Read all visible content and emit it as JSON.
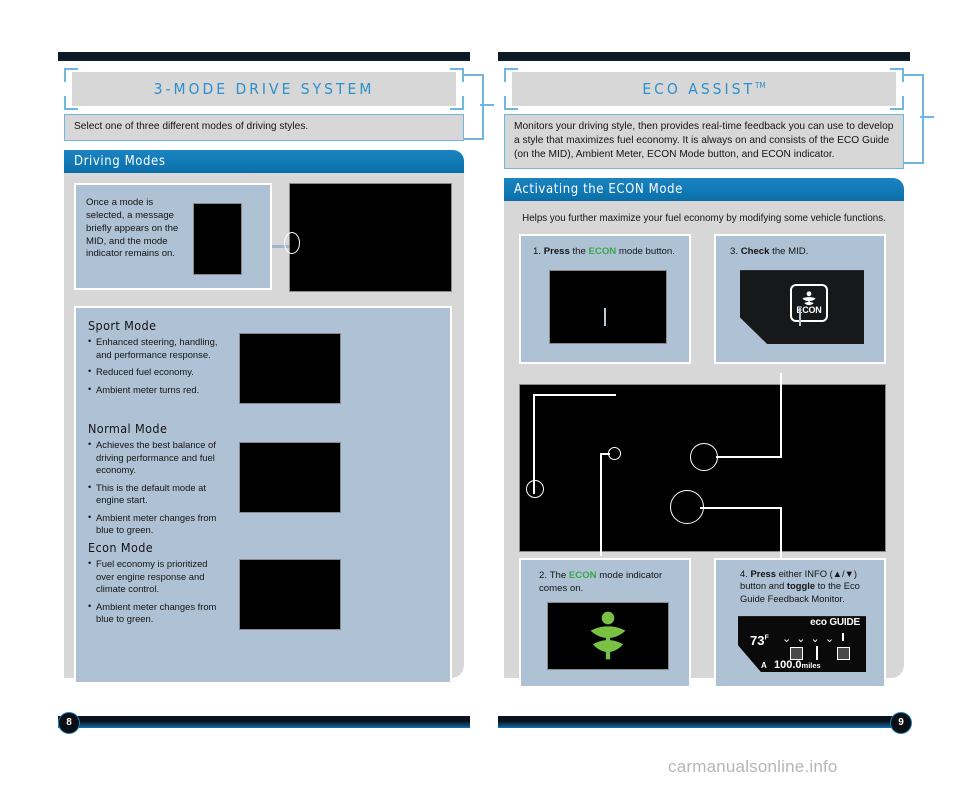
{
  "left_page": {
    "page_number": "8",
    "title": "3-MODE DRIVE SYSTEM",
    "intro": "Select one of three different modes of driving styles.",
    "section": {
      "heading": "Driving Modes",
      "note_box": {
        "text": "Once a mode is selected, a message briefly appears on the MID, and the mode indicator remains on."
      },
      "modes": [
        {
          "name": "Sport Mode",
          "bullets": [
            "Enhanced steering, handling, and performance response.",
            "Reduced fuel economy.",
            "Ambient meter turns red."
          ]
        },
        {
          "name": "Normal Mode",
          "bullets": [
            "Achieves the best balance of driving performance and fuel economy.",
            "This is the default mode at engine start.",
            "Ambient meter changes from blue to green."
          ]
        },
        {
          "name": "Econ Mode",
          "bullets": [
            "Fuel economy is prioritized over engine response and climate control.",
            "Ambient meter changes from blue to green."
          ]
        }
      ]
    }
  },
  "right_page": {
    "page_number": "9",
    "title": "ECO ASSIST",
    "title_tm": "TM",
    "intro": "Monitors your driving style, then provides real-time feedback you can use to develop a style that maximizes fuel economy. It is always on and consists of the ECO Guide (on the MID),  Ambient Meter, ECON Mode button, and ECON indicator.",
    "section": {
      "heading": "Activating the ECON Mode",
      "lead": "Helps you further maximize your fuel economy by modifying some vehicle functions.",
      "steps": [
        {
          "number": "1.",
          "parts": [
            {
              "text": "Press",
              "style": "bold"
            },
            {
              "text": " the ",
              "style": "normal"
            },
            {
              "text": "ECON",
              "style": "econ"
            },
            {
              "text": " mode button.",
              "style": "normal"
            }
          ]
        },
        {
          "number": "3.",
          "parts": [
            {
              "text": "Check",
              "style": "bold"
            },
            {
              "text": " the MID.",
              "style": "normal"
            }
          ]
        },
        {
          "number": "2.",
          "parts": [
            {
              "text": "The ",
              "style": "normal"
            },
            {
              "text": "ECON",
              "style": "econ"
            },
            {
              "text": " mode indicator comes on.",
              "style": "normal"
            }
          ]
        },
        {
          "number": "4.",
          "parts": [
            {
              "text": "Press",
              "style": "bold"
            },
            {
              "text": " either INFO (▲/▼) button and ",
              "style": "normal"
            },
            {
              "text": "toggle",
              "style": "bold"
            },
            {
              "text": " to the Eco Guide Feedback Monitor.",
              "style": "normal"
            }
          ]
        }
      ],
      "econ_button": {
        "label": "ECON",
        "icon": "eco-plant-icon"
      },
      "eco_guide": {
        "title": "eco GUIDE",
        "temperature": "73",
        "temperature_unit": "F",
        "odometer": "100.0",
        "odometer_unit": "miles",
        "trip_label": "A"
      },
      "econ_indicator_icon": "eco-plant-green-icon"
    }
  },
  "watermark": "carmanualsonline.info",
  "colors": {
    "accent_blue": "#1b83bf",
    "title_blue": "#2b90cc",
    "bracket_blue": "#6fb7de",
    "panel_blue": "#afc1d4",
    "panel_gray": "#d7d7d7",
    "econ_green": "#3aa84b",
    "plant_green": "#7ac143"
  }
}
